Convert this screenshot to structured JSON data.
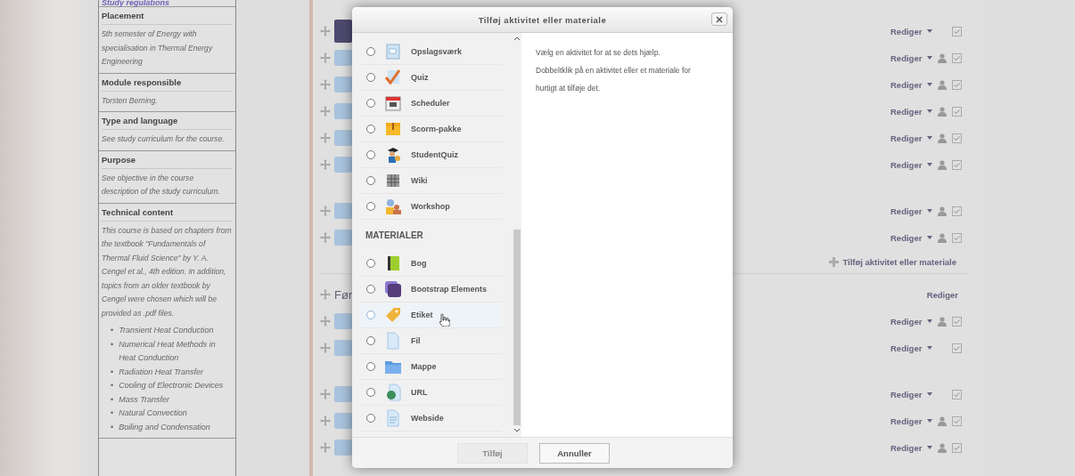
{
  "regulations": {
    "link": "Study regulations"
  },
  "table": [
    {
      "heading": "Placement",
      "text": "5th semester of Energy with specialisation in Thermal Energy Engineering"
    },
    {
      "heading": "Module responsible",
      "text": "Torsten Berning."
    },
    {
      "heading": "Type and language",
      "text": "See study curriculum for the course."
    },
    {
      "heading": "Purpose",
      "text": "See objective in the course description of the study curriculum."
    },
    {
      "heading": "Technical content",
      "text": "This course is based  on chapters from the textbook \"Fundamentals of Thermal Fluid Science\" by Y. A. Cengel et al., 4th edition. In addition, topics from an older textbook by Cengel were chosen which will be provided as .pdf files.",
      "marker": "•",
      "bullets": [
        "Transient Heat Conduction",
        "Numerical Heat Methods in Heat Conduction",
        "Radiation Heat Transfer",
        "Cooling of Electronic Devices",
        "Mass Transfer",
        "Natural Convection",
        "Boiling and Condensation"
      ]
    }
  ],
  "course_rows": [
    {
      "kind": "activity",
      "edit": "Rediger",
      "person": false,
      "spaced": false,
      "highlight": true
    },
    {
      "kind": "activity",
      "edit": "Rediger",
      "person": true,
      "spaced": false,
      "highlight": false
    },
    {
      "kind": "activity",
      "edit": "Rediger",
      "person": true,
      "spaced": false,
      "highlight": false
    },
    {
      "kind": "activity",
      "edit": "Rediger",
      "person": true,
      "spaced": false,
      "highlight": false
    },
    {
      "kind": "activity",
      "edit": "Rediger",
      "person": true,
      "spaced": false,
      "highlight": false
    },
    {
      "kind": "activity",
      "edit": "Rediger",
      "person": true,
      "spaced": false,
      "highlight": false
    },
    {
      "kind": "activity",
      "edit": "Rediger",
      "person": true,
      "spaced": true,
      "highlight": false
    },
    {
      "kind": "activity",
      "edit": "Rediger",
      "person": true,
      "spaced": false,
      "highlight": false
    },
    {
      "kind": "add",
      "label": "Tilføj aktivitet eller materiale"
    },
    {
      "kind": "section",
      "title": "Før",
      "edit": "Rediger"
    },
    {
      "kind": "activity",
      "edit": "Rediger",
      "person": true,
      "spaced": false,
      "highlight": false
    },
    {
      "kind": "activity",
      "edit": "Rediger",
      "person": false,
      "spaced": false,
      "highlight": false
    },
    {
      "kind": "activity",
      "edit": "Rediger",
      "person": false,
      "spaced": true,
      "highlight": false
    },
    {
      "kind": "activity",
      "edit": "Rediger",
      "person": true,
      "spaced": false,
      "highlight": false
    },
    {
      "kind": "activity",
      "edit": "Rediger",
      "person": true,
      "spaced": false,
      "highlight": false
    }
  ],
  "dialog": {
    "title": "Tilføj aktivitet eller materiale",
    "groups": [
      {
        "items": [
          {
            "label": "Opslagsværk",
            "kind": "glossary",
            "selected": false,
            "hovered": false
          },
          {
            "label": "Quiz",
            "kind": "quiz",
            "selected": false,
            "hovered": false
          },
          {
            "label": "Scheduler",
            "kind": "calendar",
            "selected": false,
            "hovered": false
          },
          {
            "label": "Scorm-pakke",
            "kind": "package",
            "selected": false,
            "hovered": false
          },
          {
            "label": "StudentQuiz",
            "kind": "students",
            "selected": false,
            "hovered": false
          },
          {
            "label": "Wiki",
            "kind": "wiki",
            "selected": false,
            "hovered": false
          },
          {
            "label": "Workshop",
            "kind": "workshop",
            "selected": false,
            "hovered": false
          }
        ]
      },
      {
        "heading": "MATERIALER",
        "items": [
          {
            "label": "Bog",
            "kind": "book",
            "selected": false,
            "hovered": false
          },
          {
            "label": "Bootstrap Elements",
            "kind": "bootstrap",
            "selected": false,
            "hovered": false
          },
          {
            "label": "Etiket",
            "kind": "label",
            "selected": false,
            "hovered": true
          },
          {
            "label": "Fil",
            "kind": "file",
            "selected": false,
            "hovered": false
          },
          {
            "label": "Mappe",
            "kind": "folder",
            "selected": false,
            "hovered": false
          },
          {
            "label": "URL",
            "kind": "url",
            "selected": false,
            "hovered": false
          },
          {
            "label": "Webside",
            "kind": "page",
            "selected": false,
            "hovered": false
          }
        ]
      }
    ],
    "help": "Vælg en aktivitet for at se dets hjælp. Dobbeltklik på en aktivitet eller et materiale for hurtigt at tilføje det.",
    "buttons": [
      {
        "label": "Tilføj",
        "disabled": true
      },
      {
        "label": "Annuller",
        "disabled": false
      }
    ]
  }
}
